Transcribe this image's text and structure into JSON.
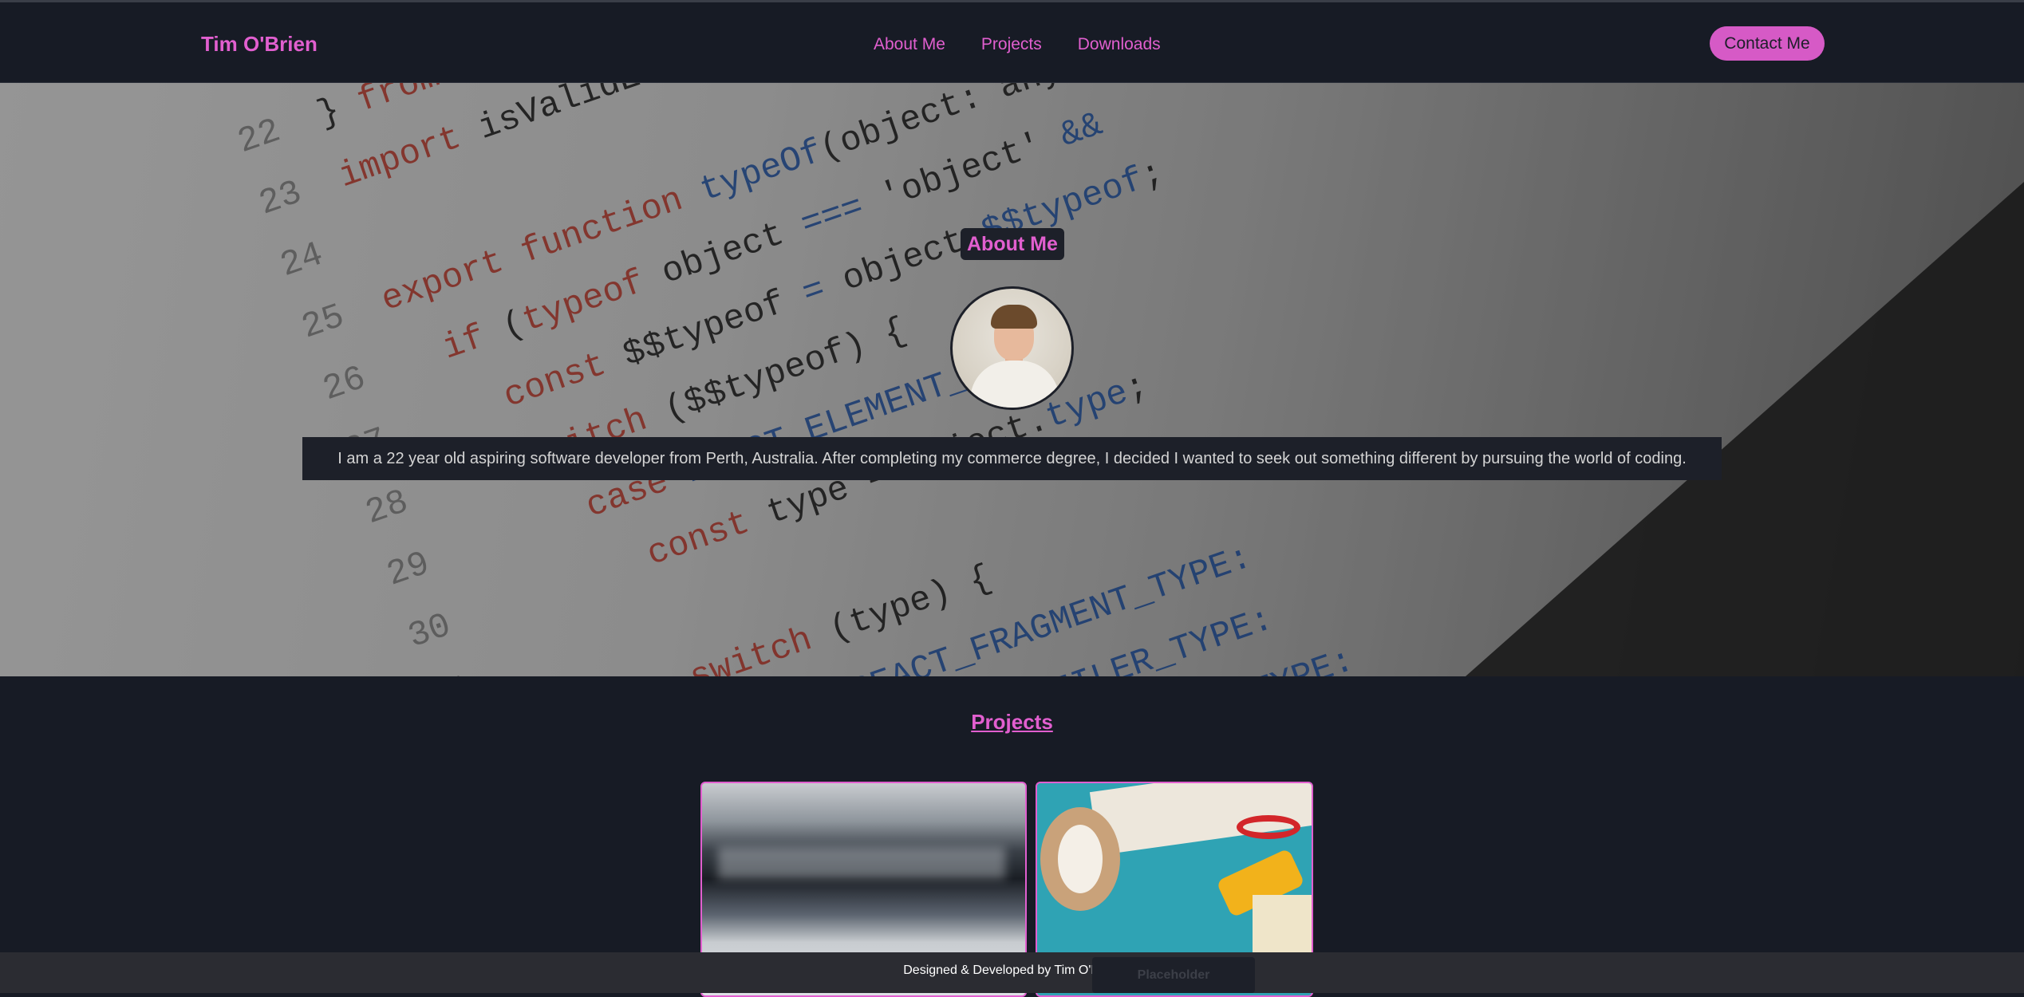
{
  "nav": {
    "brand": "Tim O'Brien",
    "links": [
      "About Me",
      "Projects",
      "Downloads"
    ],
    "contact_label": "Contact Me"
  },
  "about": {
    "title": "About Me",
    "avatar_alt": "profile photo",
    "text": "I am a 22 year old aspiring software developer from Perth, Australia. After completing my commerce degree, I decided I wanted to seek out something different by pursuing the world of coding."
  },
  "projects": {
    "title": "Projects",
    "cards": [
      {
        "image": "blurred-photo"
      },
      {
        "image": "craft-tools-photo",
        "button_label": "Placeholder"
      }
    ]
  },
  "footer": {
    "text": "Designed & Developed by Tim O'Brien"
  },
  "colors": {
    "accent": "#e15fcf",
    "background": "#171b25",
    "panel": "#1d2029",
    "footer": "#2b2c32"
  }
}
